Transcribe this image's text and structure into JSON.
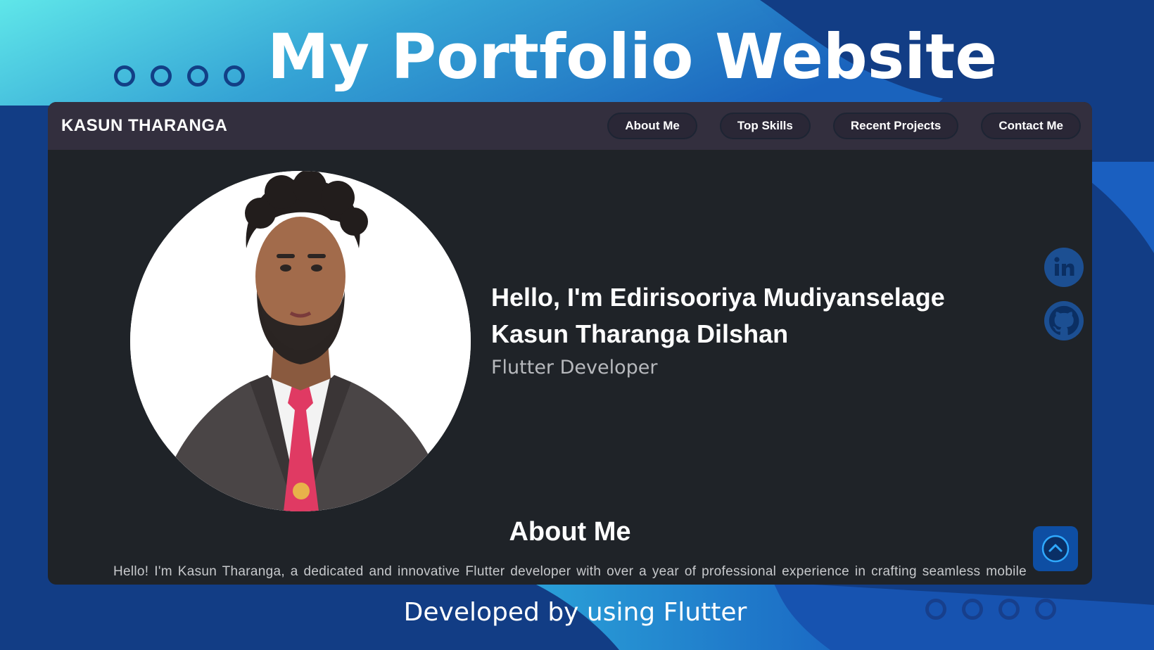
{
  "banner": {
    "title": "My Portfolio Website",
    "footer": "Developed by using Flutter"
  },
  "appbar": {
    "brand": "KASUN THARANGA",
    "nav": [
      "About Me",
      "Top Skills",
      "Recent Projects",
      "Contact Me"
    ]
  },
  "hero": {
    "greeting": "Hello, I'm Edirisooriya Mudiyanselage Kasun Tharanga Dilshan",
    "role": "Flutter Developer"
  },
  "social": {
    "items": [
      "linkedin-icon",
      "github-icon"
    ]
  },
  "about": {
    "title": "About Me",
    "text": "Hello! I'm Kasun Tharanga, a dedicated and innovative Flutter developer with over a year of professional experience in crafting seamless mobile"
  },
  "icons": {
    "scroll_top": "chevron-up-icon"
  },
  "colors": {
    "window_bg": "#1f2328",
    "appbar_bg": "#332f3e",
    "accent_blue": "#0e4ea3",
    "banner_cyan": "#5fe3e8",
    "banner_navy": "#0f3c86"
  }
}
